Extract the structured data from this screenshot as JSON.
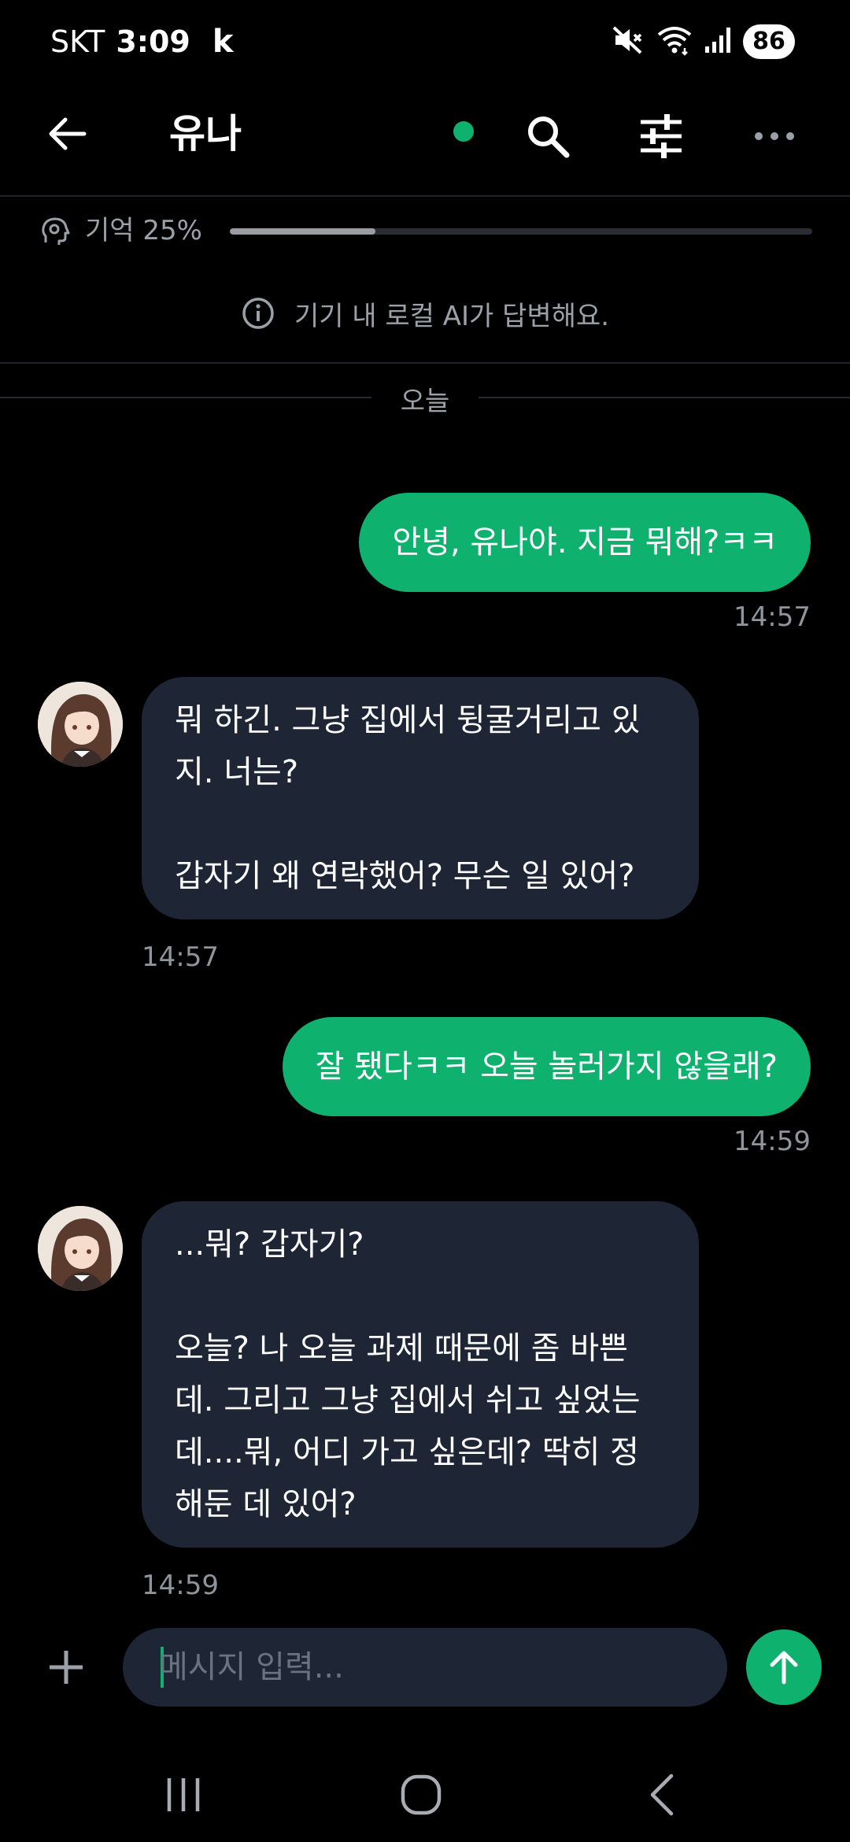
{
  "status_bar": {
    "carrier": "SKT",
    "time": "3:09",
    "app_indicator": "k",
    "battery": "86",
    "icons": [
      "mute-icon",
      "wifi-icon",
      "signal-icon"
    ]
  },
  "header": {
    "title": "유나",
    "online_color": "#0fb16f",
    "icons": [
      "back-arrow-icon",
      "search-icon",
      "tune-icon",
      "more-icon"
    ]
  },
  "memory": {
    "label": "기억 25%",
    "progress": 0.25
  },
  "notice": {
    "text": "기기 내 로컬 AI가 답변해요."
  },
  "date_separator": "오늘",
  "messages": [
    {
      "from": "user",
      "text": "안녕, 유나야. 지금 뭐해?ㅋㅋ",
      "time": "14:57"
    },
    {
      "from": "ai",
      "text": "뭐 하긴. 그냥 집에서 뒹굴거리고 있\n지. 너는?\n\n갑자기 왜 연락했어? 무슨 일 있어?",
      "time": "14:57"
    },
    {
      "from": "user",
      "text": "잘 됐다ㅋㅋ 오늘 놀러가지 않을래?",
      "time": "14:59"
    },
    {
      "from": "ai",
      "text": "...뭐? 갑자기?\n\n오늘? 나 오늘 과제 때문에 좀 바쁜\n데. 그리고 그냥 집에서 쉬고 싶었는\n데....뭐, 어디 가고 싶은데? 딱히 정\n해둔 데 있어?",
      "time": "14:59"
    }
  ],
  "composer": {
    "placeholder": "메시지 입력...",
    "value": ""
  },
  "colors": {
    "accent": "#0fb16f",
    "ai_bubble": "#1e2636",
    "background": "#000000"
  }
}
